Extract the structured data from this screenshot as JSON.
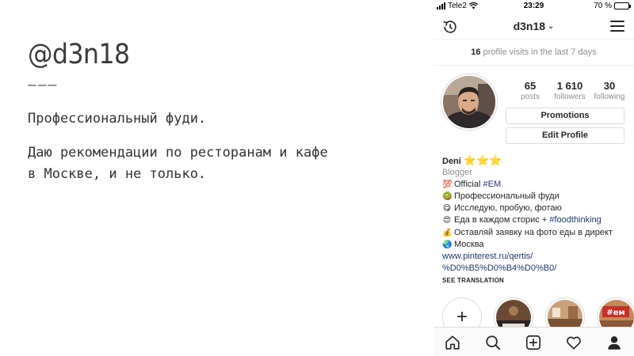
{
  "slide": {
    "handle": "@d3n18",
    "rule": "———",
    "line1": "Профессиональный фуди.",
    "line2": "Даю рекомендации по ресторанам и кафе в Москве, и не только."
  },
  "status_bar": {
    "carrier": "Tele2",
    "time": "23:29",
    "battery": "70 %",
    "battery_level": 0.7
  },
  "nav": {
    "username": "d3n18",
    "icons": [
      "history-icon",
      "chevron-down-icon",
      "menu-icon"
    ]
  },
  "visits": {
    "count": "16",
    "text": "profile visits in the last 7 days"
  },
  "stats": [
    {
      "value": "65",
      "label": "posts"
    },
    {
      "value": "1 610",
      "label": "followers"
    },
    {
      "value": "30",
      "label": "following"
    }
  ],
  "buttons": {
    "promotions": "Promotions",
    "edit_profile": "Edit Profile"
  },
  "bio": {
    "name": "Deni",
    "stars": "⭐⭐⭐",
    "category": "Blogger",
    "lines": [
      {
        "emoji": "💯",
        "text": "Official ",
        "tag": "#EM"
      },
      {
        "emoji": "🥝",
        "text": "Профессиональный фуди",
        "tag": ""
      },
      {
        "emoji": "😋",
        "text": "Исследую, пробую, фотаю",
        "tag": ""
      },
      {
        "emoji": "😍",
        "text": "Еда в каждом сторис + ",
        "tag": "#foodthinking"
      },
      {
        "emoji": "💰",
        "text": "Оставляй заявку на фото еды в директ",
        "tag": ""
      },
      {
        "emoji": "🌏",
        "text": "Москва",
        "tag": ""
      }
    ],
    "link_line1": "www.pinterest.ru/qertis/",
    "link_line2": "%D0%B5%D0%B4%D0%B0/"
  },
  "see_translation": "SEE TRANSLATION",
  "highlights": {
    "new_label": "+",
    "third_badge": "#eм"
  },
  "tabbar": [
    "home-icon",
    "search-icon",
    "add-post-icon",
    "activity-heart-icon",
    "profile-icon"
  ],
  "colors": {
    "link": "#1d3a6b",
    "muted": "#8e8e8e",
    "border": "#dbdbdb",
    "text": "#262626"
  }
}
